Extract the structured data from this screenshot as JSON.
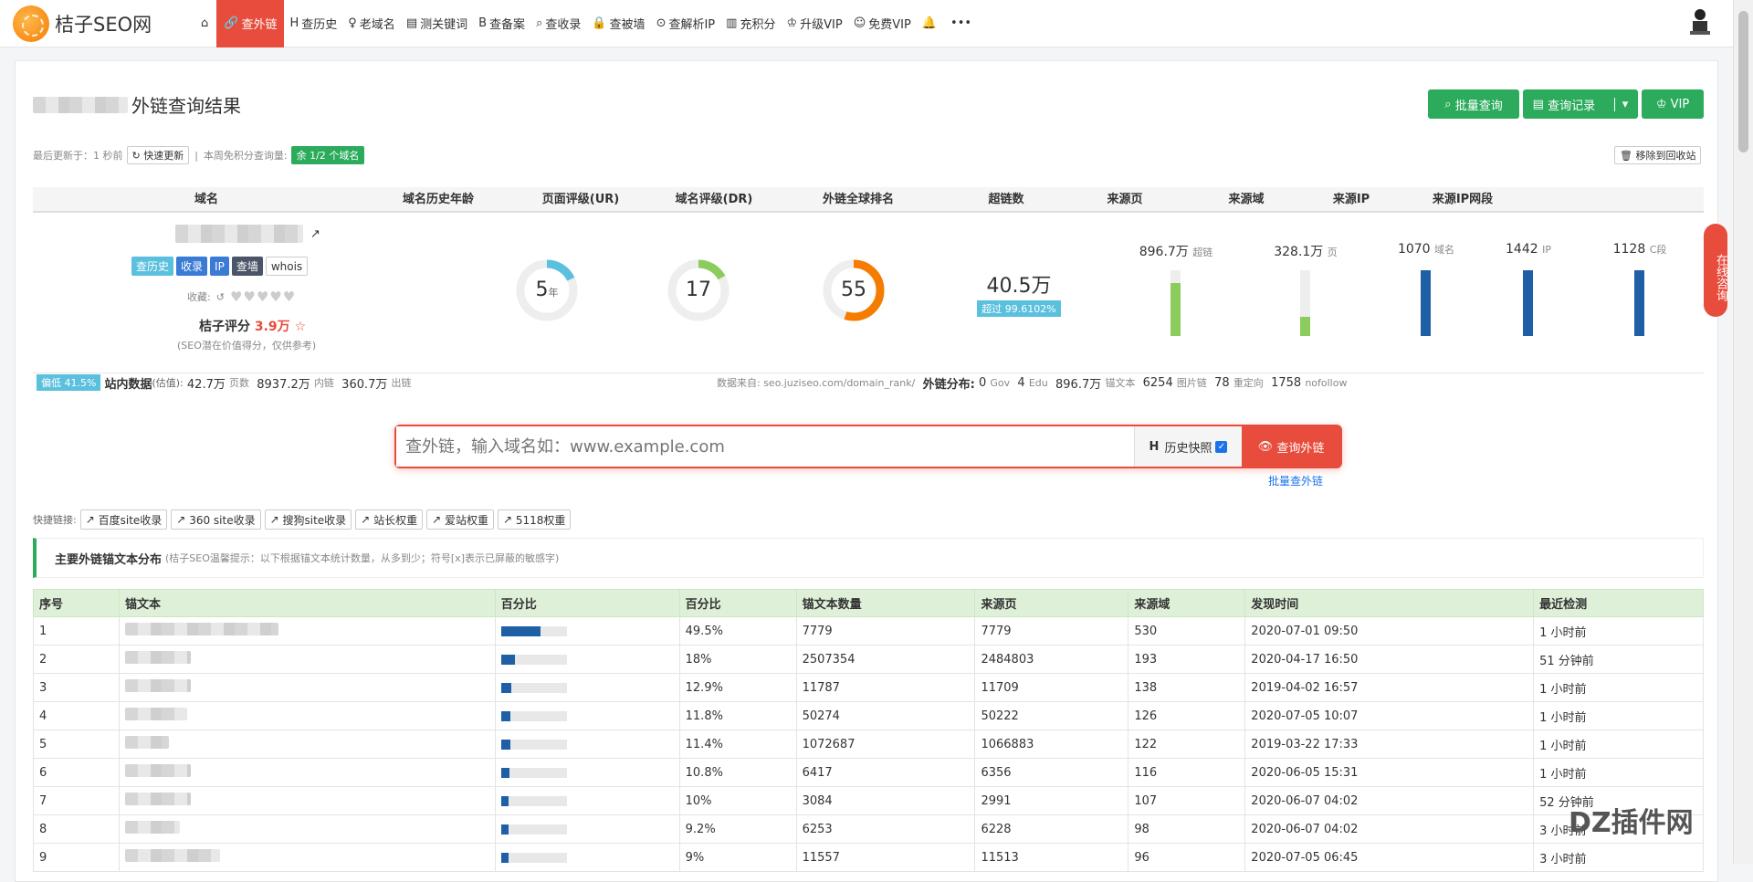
{
  "nav": {
    "logo": "桔子SEO网",
    "items": [
      {
        "icon": "⌂",
        "label": ""
      },
      {
        "icon": "🔗",
        "label": "查外链",
        "active": true
      },
      {
        "icon": "H",
        "label": "查历史"
      },
      {
        "icon": "♀",
        "label": "老域名"
      },
      {
        "icon": "▤",
        "label": "测关键词"
      },
      {
        "icon": "B",
        "label": "查备案"
      },
      {
        "icon": "⌕",
        "label": "查收录"
      },
      {
        "icon": "🔒",
        "label": "查被墙"
      },
      {
        "icon": "⊙",
        "label": "查解析IP"
      },
      {
        "icon": "▥",
        "label": "充积分"
      },
      {
        "icon": "♔",
        "label": "升级VIP"
      },
      {
        "icon": "☺",
        "label": "免费VIP"
      },
      {
        "icon": "🔔",
        "label": ""
      },
      {
        "icon": "•••",
        "label": ""
      }
    ]
  },
  "header": {
    "title": "外链查询结果",
    "batch": "批量查询",
    "history": "查询记录",
    "vip": "VIP",
    "updated": "最后更新于：1 秒前",
    "refresh": "快速更新",
    "free_label": "本周免积分查询量:",
    "free_badge": "余 1/2 个域名",
    "recycle": "移除到回收站"
  },
  "stats": {
    "headers": [
      "域名",
      "域名历史年龄",
      "页面评级(UR)",
      "域名评级(DR)",
      "外链全球排名",
      "超链数",
      "来源页",
      "来源域",
      "来源IP",
      "来源IP网段"
    ],
    "age": "5",
    "age_unit": "年",
    "age_frac": 0.18,
    "ur": "17",
    "ur_frac": 0.17,
    "dr": "55",
    "dr_frac": 0.55,
    "rank": "40.5万",
    "rank_badge": "超过 99.6102%",
    "links": [
      {
        "val": "896.7万",
        "unit": "超链",
        "frac": 0.8,
        "color": "#8ccc5c"
      },
      {
        "val": "328.1万",
        "unit": "页",
        "frac": 0.29,
        "color": "#8ccc5c"
      },
      {
        "val": "1070",
        "unit": "域名",
        "frac": 1,
        "color": "#1e5fa6"
      },
      {
        "val": "1442",
        "unit": "IP",
        "frac": 1,
        "color": "#1e5fa6"
      },
      {
        "val": "1128",
        "unit": "C段",
        "frac": 1,
        "color": "#1e5fa6"
      }
    ],
    "tags": [
      "查历史",
      "收录",
      "IP",
      "查墙",
      "whois"
    ],
    "fav": "收藏:",
    "score_label": "桔子评分",
    "score": "3.9万",
    "score_note": "(SEO潜在价值得分，仅供参考)"
  },
  "sitebar": {
    "bias": "偏低 41.5%",
    "site_data": "站内数据",
    "est": "(估值):",
    "pages": "42.7万",
    "pages_u": "页数",
    "inner": "8937.2万",
    "inner_u": "内链",
    "outer": "360.7万",
    "outer_u": "出链",
    "source": "数据来自: seo.juziseo.com/domain_rank/",
    "dist": "外链分布:",
    "gov": "0",
    "gov_u": "Gov",
    "edu": "4",
    "edu_u": "Edu",
    "anchor": "896.7万",
    "anchor_u": "锚文本",
    "img": "6254",
    "img_u": "图片链",
    "redir": "78",
    "redir_u": "重定向",
    "nofollow": "1758",
    "nofollow_u": "nofollow"
  },
  "search": {
    "placeholder": "查外链，输入域名如：www.example.com",
    "history": "历史快照",
    "button": "查询外链",
    "batch": "批量查外链"
  },
  "quick": {
    "label": "快捷链接:",
    "links": [
      "百度site收录",
      "360 site收录",
      "搜狗site收录",
      "站长权重",
      "爱站权重",
      "5118权重"
    ]
  },
  "section": {
    "title": "主要外链锚文本分布",
    "note": "(桔子SEO温馨提示：以下根据锚文本统计数量，从多到少；符号[x]表示已屏蔽的敏感字)"
  },
  "table": {
    "headers": [
      "序号",
      "锚文本",
      "百分比",
      "百分比",
      "锚文本数量",
      "来源页",
      "来源域",
      "发现时间",
      "最近检测"
    ],
    "rows": [
      {
        "n": "1",
        "frac": 0.495,
        "pct": "49.5%",
        "count": "7779",
        "pages": "7779",
        "domains": "530",
        "found": "2020-07-01 09:50",
        "check": "1 小时前"
      },
      {
        "n": "2",
        "frac": 0.18,
        "pct": "18%",
        "count": "2507354",
        "pages": "2484803",
        "domains": "193",
        "found": "2020-04-17 16:50",
        "check": "51 分钟前"
      },
      {
        "n": "3",
        "frac": 0.129,
        "pct": "12.9%",
        "count": "11787",
        "pages": "11709",
        "domains": "138",
        "found": "2019-04-02 16:57",
        "check": "1 小时前"
      },
      {
        "n": "4",
        "frac": 0.118,
        "pct": "11.8%",
        "count": "50274",
        "pages": "50222",
        "domains": "126",
        "found": "2020-07-05 10:07",
        "check": "1 小时前"
      },
      {
        "n": "5",
        "frac": 0.114,
        "pct": "11.4%",
        "count": "1072687",
        "pages": "1066883",
        "domains": "122",
        "found": "2019-03-22 17:33",
        "check": "1 小时前"
      },
      {
        "n": "6",
        "frac": 0.108,
        "pct": "10.8%",
        "count": "6417",
        "pages": "6356",
        "domains": "116",
        "found": "2020-06-05 15:31",
        "check": "1 小时前"
      },
      {
        "n": "7",
        "frac": 0.1,
        "pct": "10%",
        "count": "3084",
        "pages": "2991",
        "domains": "107",
        "found": "2020-06-07 04:02",
        "check": "52 分钟前"
      },
      {
        "n": "8",
        "frac": 0.092,
        "pct": "9.2%",
        "count": "6253",
        "pages": "6228",
        "domains": "98",
        "found": "2020-06-07 04:02",
        "check": "3 小时前"
      },
      {
        "n": "9",
        "frac": 0.09,
        "pct": "9%",
        "count": "11557",
        "pages": "11513",
        "domains": "96",
        "found": "2020-07-05 06:45",
        "check": "3 小时前"
      }
    ]
  },
  "float": "在线咨询",
  "watermark": "DZ插件网"
}
